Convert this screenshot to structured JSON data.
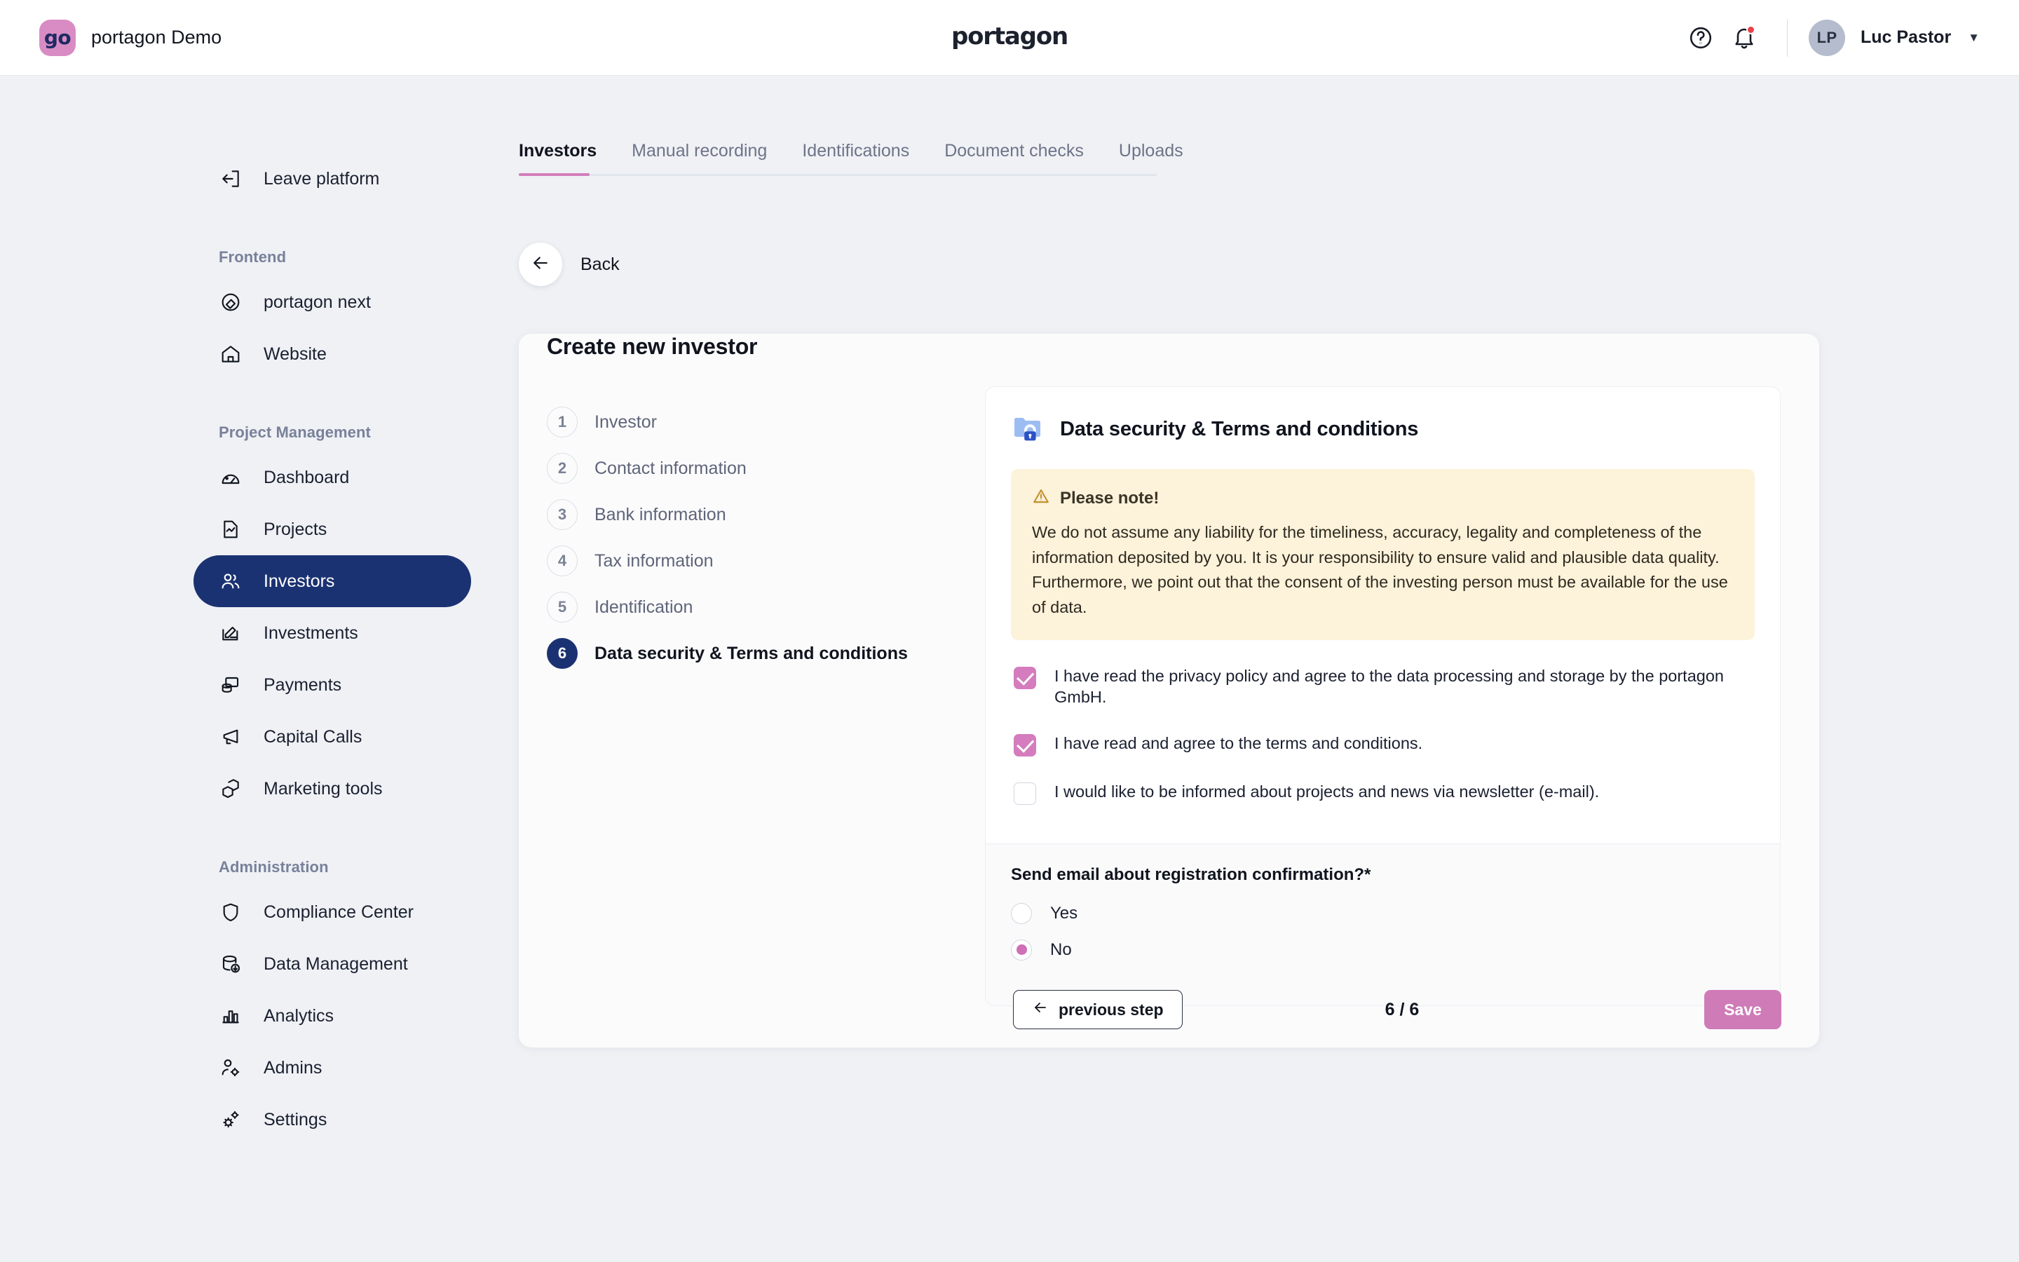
{
  "topbar": {
    "brand_logo_text": "go",
    "brand_title": "portagon Demo",
    "center_logo_text": "portagon",
    "help_icon": "help-circle-icon",
    "notification_icon": "bell-icon",
    "avatar_initials": "LP",
    "username": "Luc Pastor",
    "caret": "▼"
  },
  "sidebar": {
    "leave": {
      "label": "Leave platform",
      "icon": "logout-icon"
    },
    "sections": [
      {
        "title": "Frontend",
        "items": [
          {
            "label": "portagon next",
            "icon": "layers-circle-icon",
            "active": false
          },
          {
            "label": "Website",
            "icon": "home-icon",
            "active": false
          }
        ]
      },
      {
        "title": "Project Management",
        "items": [
          {
            "label": "Dashboard",
            "icon": "gauge-icon",
            "active": false
          },
          {
            "label": "Projects",
            "icon": "file-chart-icon",
            "active": false
          },
          {
            "label": "Investors",
            "icon": "users-icon",
            "active": true
          },
          {
            "label": "Investments",
            "icon": "edit-card-icon",
            "active": false
          },
          {
            "label": "Payments",
            "icon": "coins-icon",
            "active": false
          },
          {
            "label": "Capital Calls",
            "icon": "megaphone-icon",
            "active": false
          },
          {
            "label": "Marketing tools",
            "icon": "box-icon",
            "active": false
          }
        ]
      },
      {
        "title": "Administration",
        "items": [
          {
            "label": "Compliance Center",
            "icon": "shield-icon",
            "active": false
          },
          {
            "label": "Data Management",
            "icon": "database-download-icon",
            "active": false
          },
          {
            "label": "Analytics",
            "icon": "bar-chart-icon",
            "active": false
          },
          {
            "label": "Admins",
            "icon": "user-gear-icon",
            "active": false
          },
          {
            "label": "Settings",
            "icon": "gears-icon",
            "active": false
          }
        ]
      }
    ]
  },
  "tabs": [
    {
      "label": "Investors",
      "active": true
    },
    {
      "label": "Manual recording",
      "active": false
    },
    {
      "label": "Identifications",
      "active": false
    },
    {
      "label": "Document checks",
      "active": false
    },
    {
      "label": "Uploads",
      "active": false
    }
  ],
  "back": {
    "label": "Back",
    "icon": "arrow-left-icon"
  },
  "card": {
    "title": "Create new investor",
    "steps": [
      {
        "num": "1",
        "label": "Investor",
        "active": false
      },
      {
        "num": "2",
        "label": "Contact information",
        "active": false
      },
      {
        "num": "3",
        "label": "Bank information",
        "active": false
      },
      {
        "num": "4",
        "label": "Tax information",
        "active": false
      },
      {
        "num": "5",
        "label": "Identification",
        "active": false
      },
      {
        "num": "6",
        "label": "Data security & Terms and conditions",
        "active": true
      }
    ],
    "panel": {
      "icon": "folder-lock-icon",
      "title": "Data security & Terms and conditions",
      "note": {
        "icon": "warning-triangle-icon",
        "title": "Please note!",
        "text": "We do not assume any liability for the timeliness, accuracy, legality and completeness of the information deposited by you. It is your responsibility to ensure valid and plausible data quality. Furthermore, we point out that the consent of the investing person must be available for the use of data."
      },
      "checkboxes": [
        {
          "label": "I have read the privacy policy and agree to the data processing and storage by the portagon GmbH.",
          "checked": true
        },
        {
          "label": "I have read and agree to the terms and conditions.",
          "checked": true
        },
        {
          "label": "I would like to be informed about projects and news via newsletter (e-mail).",
          "checked": false
        }
      ],
      "radio_group": {
        "question": "Send email about registration confirmation?*",
        "options": [
          {
            "label": "Yes",
            "selected": false
          },
          {
            "label": "No",
            "selected": true
          }
        ]
      }
    },
    "actions": {
      "previous_label": "previous step",
      "previous_icon": "arrow-left-icon",
      "page_count": "6 / 6",
      "save_label": "Save"
    }
  },
  "colors": {
    "accent_pink": "#cf7bb7",
    "nav_active_blue": "#1b3272",
    "note_bg": "#fdf2da",
    "page_bg": "#eff1f5"
  }
}
